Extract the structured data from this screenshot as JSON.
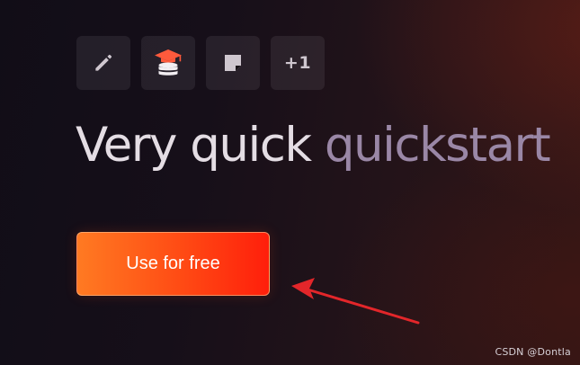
{
  "icons": [
    {
      "name": "pencil-icon",
      "color": "#cfc7cf"
    },
    {
      "name": "database-graduation-cap-icon",
      "colors": {
        "cap": "#ff5a3c",
        "db": "#f2eef2"
      }
    },
    {
      "name": "sticky-note-icon",
      "color": "#cfc7cf"
    },
    {
      "name": "more-count",
      "label": "+1"
    }
  ],
  "headline": {
    "part1": "Very quick ",
    "part2": "quickstart"
  },
  "cta": {
    "label": "Use for free"
  },
  "annotation": {
    "arrow_color": "#e3262a"
  },
  "watermark": {
    "text": "CSDN @Dontla"
  }
}
